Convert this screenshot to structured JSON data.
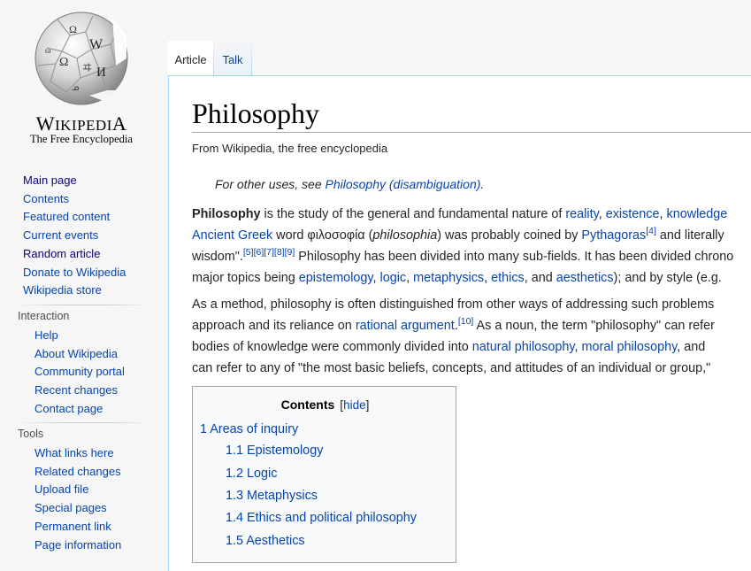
{
  "logo": {
    "wordmark": "Wikipedia",
    "tagline": "The Free Encyclopedia"
  },
  "navigation": [
    {
      "label": "Main page",
      "visited": true
    },
    {
      "label": "Contents",
      "visited": false
    },
    {
      "label": "Featured content",
      "visited": false
    },
    {
      "label": "Current events",
      "visited": false
    },
    {
      "label": "Random article",
      "visited": true
    },
    {
      "label": "Donate to Wikipedia",
      "visited": false
    },
    {
      "label": "Wikipedia store",
      "visited": false
    }
  ],
  "interaction": {
    "heading": "Interaction",
    "items": [
      "Help",
      "About Wikipedia",
      "Community portal",
      "Recent changes",
      "Contact page"
    ]
  },
  "tools": {
    "heading": "Tools",
    "items": [
      "What links here",
      "Related changes",
      "Upload file",
      "Special pages",
      "Permanent link",
      "Page information"
    ]
  },
  "tabs": {
    "article": "Article",
    "talk": "Talk"
  },
  "article": {
    "title": "Philosophy",
    "site_sub": "From Wikipedia, the free encyclopedia",
    "hatnote_prefix": "For other uses, see ",
    "hatnote_link": "Philosophy (disambiguation)",
    "hatnote_suffix": ".",
    "p1": {
      "l1": {
        "bold": "Philosophy",
        "t1": " is the study of the general and fundamental nature of ",
        "link1": "reality",
        "t2": ", ",
        "link2": "existence",
        "t3": ", ",
        "link3": "knowledge"
      },
      "l2": {
        "link1": "Ancient Greek",
        "t1": " word φιλοσοφία (",
        "italic": "philosophia",
        "t2": ") was probably coined by ",
        "link2": "Pythagoras",
        "ref": "[4]",
        "t3": " and literally"
      },
      "l3": {
        "t1": "wisdom\".",
        "refs": "[5][6][7][8][9]",
        "t2": " Philosophy has been divided into many sub-fields. It has been divided chrono"
      },
      "l4": {
        "t1": "major topics being ",
        "link1": "epistemology",
        "t2": ", ",
        "link2": "logic",
        "t3": ", ",
        "link3": "metaphysics",
        "t4": ", ",
        "link4": "ethics",
        "t5": ", and ",
        "link5": "aesthetics",
        "t6": "); and by style (e.g."
      }
    },
    "p2": {
      "l1": {
        "t1": "As a method, philosophy is often distinguished from other ways of addressing such problems"
      },
      "l2": {
        "t1": "approach and its reliance on ",
        "link1": "rational argument",
        "t2": ".",
        "ref": "[10]",
        "t3": " As a noun, the term \"philosophy\" can refer"
      },
      "l3": {
        "t1": "bodies of knowledge were commonly divided into ",
        "link1": "natural philosophy",
        "t2": ", ",
        "link2": "moral philosophy",
        "t3": ", and"
      },
      "l4": {
        "t1": "can refer to any of \"the most basic beliefs, concepts, and attitudes of an individual or group,\""
      }
    }
  },
  "toc": {
    "title": "Contents",
    "hide_open": "[",
    "hide_label": "hide",
    "hide_close": "]",
    "items": [
      {
        "text": "1 Areas of inquiry",
        "level": 1
      },
      {
        "text": "1.1 Epistemology",
        "level": 2
      },
      {
        "text": "1.2 Logic",
        "level": 2
      },
      {
        "text": "1.3 Metaphysics",
        "level": 2
      },
      {
        "text": "1.4 Ethics and political philosophy",
        "level": 2
      },
      {
        "text": "1.5 Aesthetics",
        "level": 2
      }
    ]
  }
}
